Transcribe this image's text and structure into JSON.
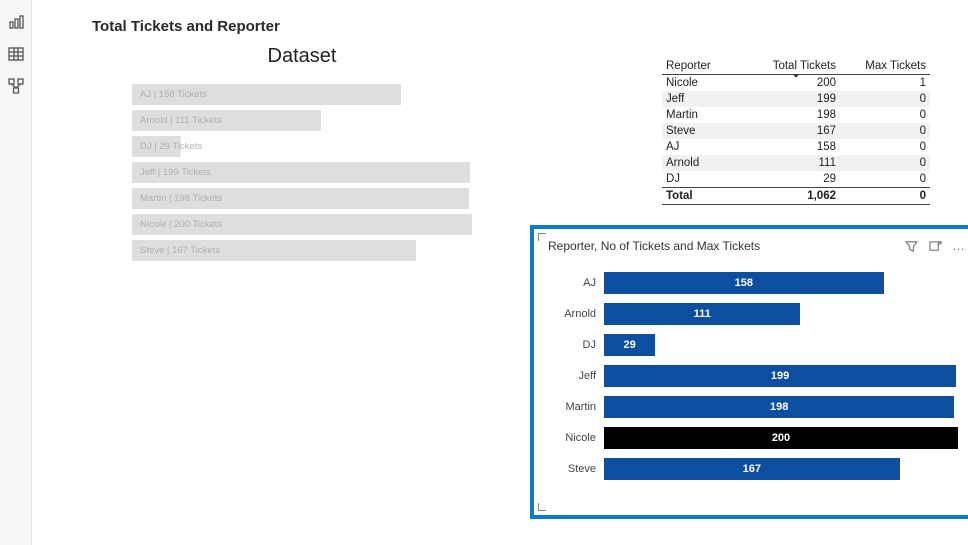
{
  "rail": {
    "icons": [
      "report-view-icon",
      "data-view-icon",
      "model-view-icon"
    ]
  },
  "chart_a": {
    "title": "Total Tickets and Reporter",
    "subtitle": "Dataset",
    "rows": [
      {
        "label": "AJ | 158 Tickets",
        "value": 158
      },
      {
        "label": "Arnold | 111 Tickets",
        "value": 111
      },
      {
        "label": "DJ | 29 Tickets",
        "value": 29
      },
      {
        "label": "Jeff | 199 Tickets",
        "value": 199
      },
      {
        "label": "Martin | 198 Tickets",
        "value": 198
      },
      {
        "label": "Nicole | 200 Tickets",
        "value": 200
      },
      {
        "label": "Steve | 167 Tickets",
        "value": 167
      }
    ]
  },
  "table": {
    "headers": {
      "c1": "Reporter",
      "c2": "Total Tickets",
      "c3": "Max Tickets"
    },
    "rows": [
      {
        "c1": "Nicole",
        "c2": "200",
        "c3": "1"
      },
      {
        "c1": "Jeff",
        "c2": "199",
        "c3": "0"
      },
      {
        "c1": "Martin",
        "c2": "198",
        "c3": "0"
      },
      {
        "c1": "Steve",
        "c2": "167",
        "c3": "0"
      },
      {
        "c1": "AJ",
        "c2": "158",
        "c3": "0"
      },
      {
        "c1": "Arnold",
        "c2": "111",
        "c3": "0"
      },
      {
        "c1": "DJ",
        "c2": "29",
        "c3": "0"
      }
    ],
    "total": {
      "c1": "Total",
      "c2": "1,062",
      "c3": "0"
    }
  },
  "chart_b": {
    "title": "Reporter, No of Tickets and Max Tickets",
    "rows": [
      {
        "label": "AJ",
        "value": 158,
        "highlight": false
      },
      {
        "label": "Arnold",
        "value": 111,
        "highlight": false
      },
      {
        "label": "DJ",
        "value": 29,
        "highlight": false
      },
      {
        "label": "Jeff",
        "value": 199,
        "highlight": false
      },
      {
        "label": "Martin",
        "value": 198,
        "highlight": false
      },
      {
        "label": "Nicole",
        "value": 200,
        "highlight": true
      },
      {
        "label": "Steve",
        "value": 167,
        "highlight": false
      }
    ]
  },
  "colors": {
    "accent": "#0a7cc9",
    "bar_primary": "#0b4f9e",
    "bar_highlight": "#000000",
    "dataset_bar": "#dedede"
  },
  "chart_data": [
    {
      "type": "bar",
      "orientation": "horizontal",
      "title": "Total Tickets and Reporter",
      "subtitle": "Dataset",
      "categories": [
        "AJ",
        "Arnold",
        "DJ",
        "Jeff",
        "Martin",
        "Nicole",
        "Steve"
      ],
      "values": [
        158,
        111,
        29,
        199,
        198,
        200,
        167
      ],
      "xlabel": "",
      "ylabel": "",
      "ylim": [
        0,
        200
      ]
    },
    {
      "type": "table",
      "title": "Reporter / Total Tickets / Max Tickets",
      "columns": [
        "Reporter",
        "Total Tickets",
        "Max Tickets"
      ],
      "rows": [
        [
          "Nicole",
          200,
          1
        ],
        [
          "Jeff",
          199,
          0
        ],
        [
          "Martin",
          198,
          0
        ],
        [
          "Steve",
          167,
          0
        ],
        [
          "AJ",
          158,
          0
        ],
        [
          "Arnold",
          111,
          0
        ],
        [
          "DJ",
          29,
          0
        ]
      ],
      "totals": [
        "Total",
        1062,
        0
      ],
      "sort": {
        "column": "Total Tickets",
        "direction": "desc"
      }
    },
    {
      "type": "bar",
      "orientation": "horizontal",
      "title": "Reporter, No of Tickets and Max Tickets",
      "categories": [
        "AJ",
        "Arnold",
        "DJ",
        "Jeff",
        "Martin",
        "Nicole",
        "Steve"
      ],
      "values": [
        158,
        111,
        29,
        199,
        198,
        200,
        167
      ],
      "highlighted_category": "Nicole",
      "xlabel": "",
      "ylabel": "",
      "xlim": [
        0,
        200
      ],
      "legend": false
    }
  ]
}
